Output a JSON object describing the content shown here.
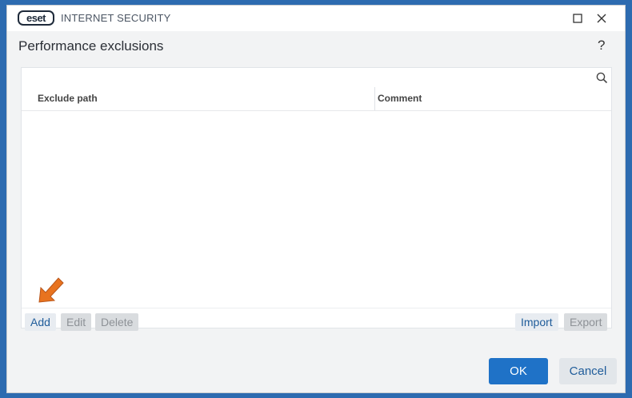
{
  "window": {
    "logo_text": "eset",
    "app_title": "INTERNET SECURITY",
    "maximize_icon": "square-outline",
    "close_icon": "x"
  },
  "page": {
    "title": "Performance exclusions",
    "help_glyph": "?"
  },
  "search": {
    "value": "",
    "placeholder": "",
    "icon": "magnifier"
  },
  "table": {
    "columns": [
      "Exclude path",
      "Comment"
    ],
    "rows": []
  },
  "actions": {
    "add": "Add",
    "edit": "Edit",
    "delete": "Delete",
    "import": "Import",
    "export": "Export"
  },
  "footer": {
    "ok": "OK",
    "cancel": "Cancel"
  },
  "colors": {
    "primary": "#1f72c7",
    "link": "#1f5c9a",
    "annotation_arrow": "#e8731f"
  }
}
